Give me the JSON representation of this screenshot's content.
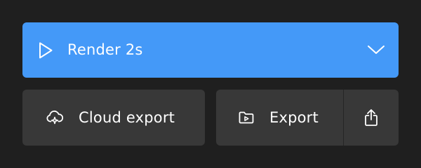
{
  "render": {
    "label": "Render 2s",
    "play_icon": "play-icon",
    "dropdown_icon": "chevron-down-icon",
    "color": "#4499f8"
  },
  "actions": {
    "cloud_export": {
      "label": "Cloud export",
      "icon": "cloud-sparkle-icon"
    },
    "export": {
      "label": "Export",
      "icon": "folder-play-icon"
    },
    "share": {
      "icon": "share-icon"
    }
  },
  "colors": {
    "background": "#1f1f1f",
    "button": "#383838",
    "text": "#ffffff"
  }
}
